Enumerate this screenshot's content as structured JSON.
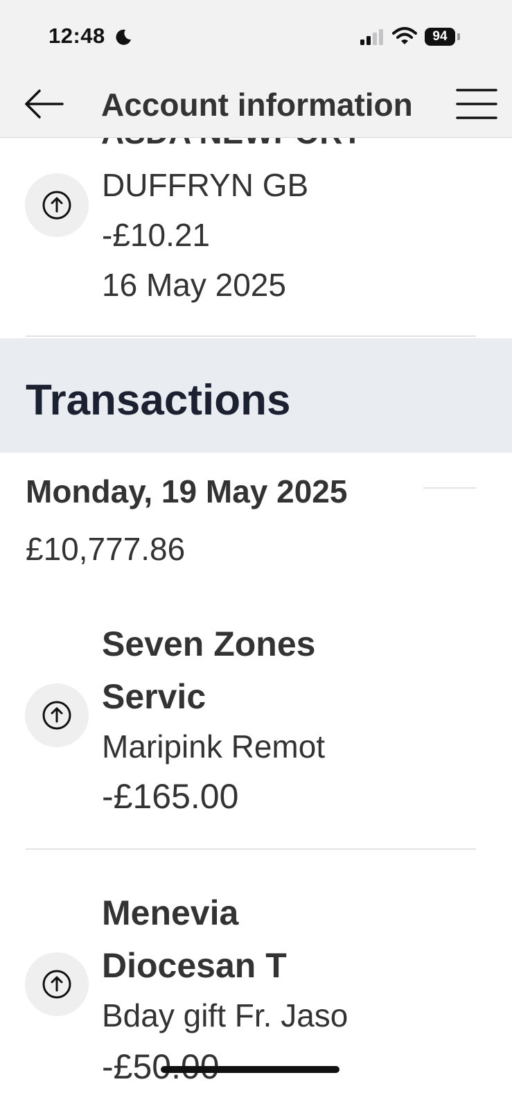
{
  "status_bar": {
    "time": "12:48",
    "battery": "94"
  },
  "nav": {
    "title": "Account information"
  },
  "previous_transaction": {
    "name_partial": "ASDA NEWPORT",
    "description": "DUFFRYN GB",
    "amount": "-£10.21",
    "date": "16 May 2025"
  },
  "section": {
    "title": "Transactions"
  },
  "day_group": {
    "date": "Monday, 19 May 2025",
    "balance": "£10,777.86"
  },
  "transactions": [
    {
      "name_line1": "Seven Zones",
      "name_line2": "Servic",
      "description": "Maripink Remot",
      "amount": "-£165.00"
    },
    {
      "name_line1": "Menevia",
      "name_line2": "Diocesan T",
      "description": "Bday gift Fr. Jaso",
      "amount": "-£50.00"
    }
  ],
  "icons": {
    "transaction": "arrow-up-circle-icon",
    "back": "arrow-left-icon",
    "menu": "hamburger-menu-icon"
  },
  "colors": {
    "header_bg": "#f2f2f3",
    "section_bg": "#e9ecf1",
    "text": "#333333",
    "section_title": "#1b2130",
    "icon_bg": "#efefef"
  }
}
